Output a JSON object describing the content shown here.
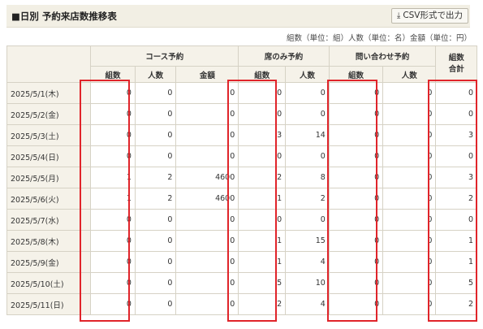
{
  "header": {
    "title": "■日別 予約来店数推移表",
    "csv_label": "CSV形式で出力",
    "download_icon": "download-icon"
  },
  "legend": "組数（単位：組）人数（単位：名）金額（単位：円）",
  "columns": {
    "groups": [
      "コース予約",
      "席のみ予約",
      "問い合わせ予約"
    ],
    "total_label": "組数\n合計",
    "sub": {
      "course": [
        "組数",
        "人数",
        "金額"
      ],
      "seat": [
        "組数",
        "人数"
      ],
      "inquiry": [
        "組数",
        "人数"
      ]
    }
  },
  "rows": [
    {
      "date": "2025/5/1(木)",
      "type": "weekday",
      "c": [
        "0",
        "0",
        "0"
      ],
      "s": [
        "0",
        "0"
      ],
      "i": [
        "0",
        "0"
      ],
      "t": "0"
    },
    {
      "date": "2025/5/2(金)",
      "type": "weekday",
      "c": [
        "0",
        "0",
        "0"
      ],
      "s": [
        "0",
        "0"
      ],
      "i": [
        "0",
        "0"
      ],
      "t": "0"
    },
    {
      "date": "2025/5/3(土)",
      "type": "holiday",
      "c": [
        "0",
        "0",
        "0"
      ],
      "s": [
        "3",
        "14"
      ],
      "i": [
        "0",
        "0"
      ],
      "t": "3"
    },
    {
      "date": "2025/5/4(日)",
      "type": "sun",
      "c": [
        "0",
        "0",
        "0"
      ],
      "s": [
        "0",
        "0"
      ],
      "i": [
        "0",
        "0"
      ],
      "t": "0"
    },
    {
      "date": "2025/5/5(月)",
      "type": "holiday",
      "c": [
        "1",
        "2",
        "4600"
      ],
      "s": [
        "2",
        "8"
      ],
      "i": [
        "0",
        "0"
      ],
      "t": "3"
    },
    {
      "date": "2025/5/6(火)",
      "type": "holiday",
      "c": [
        "1",
        "2",
        "4600"
      ],
      "s": [
        "1",
        "2"
      ],
      "i": [
        "0",
        "0"
      ],
      "t": "2"
    },
    {
      "date": "2025/5/7(水)",
      "type": "weekday",
      "c": [
        "0",
        "0",
        "0"
      ],
      "s": [
        "0",
        "0"
      ],
      "i": [
        "0",
        "0"
      ],
      "t": "0"
    },
    {
      "date": "2025/5/8(木)",
      "type": "weekday",
      "c": [
        "0",
        "0",
        "0"
      ],
      "s": [
        "1",
        "15"
      ],
      "i": [
        "0",
        "0"
      ],
      "t": "1"
    },
    {
      "date": "2025/5/9(金)",
      "type": "weekday",
      "c": [
        "0",
        "0",
        "0"
      ],
      "s": [
        "1",
        "4"
      ],
      "i": [
        "0",
        "0"
      ],
      "t": "1"
    },
    {
      "date": "2025/5/10(土)",
      "type": "sat",
      "c": [
        "0",
        "0",
        "0"
      ],
      "s": [
        "5",
        "10"
      ],
      "i": [
        "0",
        "0"
      ],
      "t": "5"
    },
    {
      "date": "2025/5/11(日)",
      "type": "sun",
      "c": [
        "0",
        "0",
        "0"
      ],
      "s": [
        "2",
        "4"
      ],
      "i": [
        "0",
        "0"
      ],
      "t": "2"
    }
  ],
  "colors": {
    "highlight": "#e0242a",
    "sunday_holiday": "#c33a2c",
    "saturday": "#3a6fc4",
    "header_bg": "#f5f2e9"
  }
}
